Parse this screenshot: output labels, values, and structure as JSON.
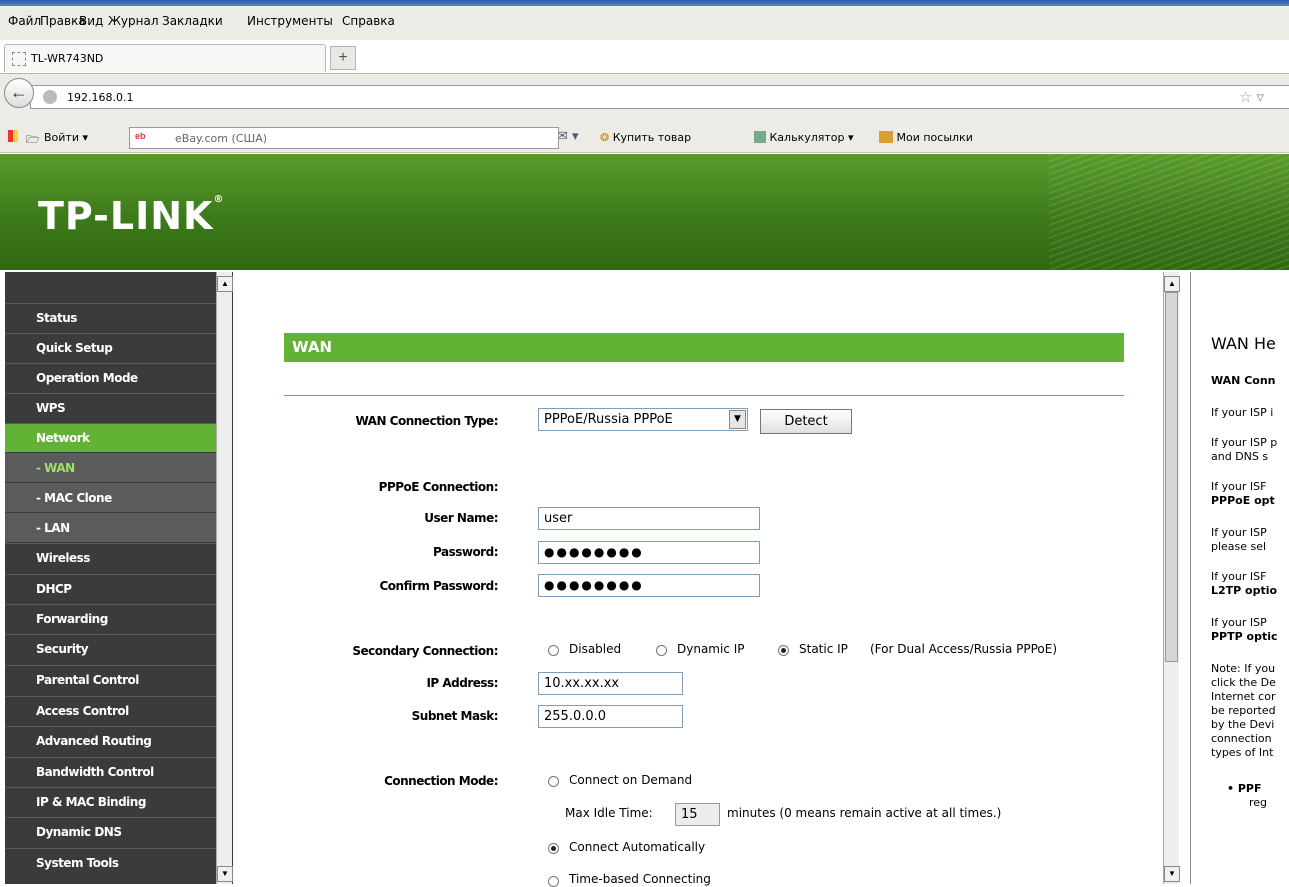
{
  "browser": {
    "menu": [
      "Файл",
      "Правка",
      "Вид",
      "Журнал",
      "Закладки",
      "Инструменты",
      "Справка"
    ],
    "tab_title": "TL-WR743ND",
    "new_tab": "+",
    "url": "192.168.0.1",
    "toolbar": {
      "login": "Войти",
      "search_text": "eBay.com (США)",
      "buy": "Купить товар",
      "calculator": "Калькулятор",
      "parcels": "Мои посылки"
    }
  },
  "header": {
    "logo": "TP-LINK"
  },
  "sidebar": {
    "items": [
      "Status",
      "Quick Setup",
      "Operation Mode",
      "WPS",
      "Network",
      "- WAN",
      "- MAC Clone",
      "- LAN",
      "Wireless",
      "DHCP",
      "Forwarding",
      "Security",
      "Parental Control",
      "Access Control",
      "Advanced Routing",
      "Bandwidth Control",
      "IP & MAC Binding",
      "Dynamic DNS",
      "System Tools"
    ]
  },
  "main": {
    "section_title": "WAN",
    "wan_type_label": "WAN Connection Type:",
    "wan_type_value": "PPPoE/Russia PPPoE",
    "detect_button": "Detect",
    "pppoe_label": "PPPoE Connection:",
    "username_label": "User Name:",
    "username_value": "user",
    "password_label": "Password:",
    "password_value": "●●●●●●●●",
    "confirm_label": "Confirm Password:",
    "confirm_value": "●●●●●●●●",
    "secondary_label": "Secondary Connection:",
    "secondary_options": [
      "Disabled",
      "Dynamic IP",
      "Static IP"
    ],
    "secondary_note": "(For Dual Access/Russia PPPoE)",
    "ip_label": "IP Address:",
    "ip_value": "10.xx.xx.xx",
    "mask_label": "Subnet Mask:",
    "mask_value": "255.0.0.0",
    "mode_label": "Connection Mode:",
    "mode_demand": "Connect on Demand",
    "max_idle_label": "Max Idle Time:",
    "max_idle_value": "15",
    "max_idle_note": "minutes (0 means remain active at all times.)",
    "mode_auto": "Connect Automatically",
    "mode_time": "Time-based Connecting"
  },
  "help": {
    "title": "WAN He",
    "lines": [
      "WAN Conn",
      "If your ISP i",
      "If your ISP p",
      "and DNS s",
      "If your ISF",
      "PPPoE opt",
      "If your ISP",
      "please sel",
      "If your ISF",
      "L2TP optio",
      "If your ISP",
      "PPTP optic",
      "Note: If you",
      "click the De",
      "Internet cor",
      "be reported",
      "by the Devi",
      "connection",
      "types of Int",
      "• PPF",
      "reg"
    ]
  }
}
